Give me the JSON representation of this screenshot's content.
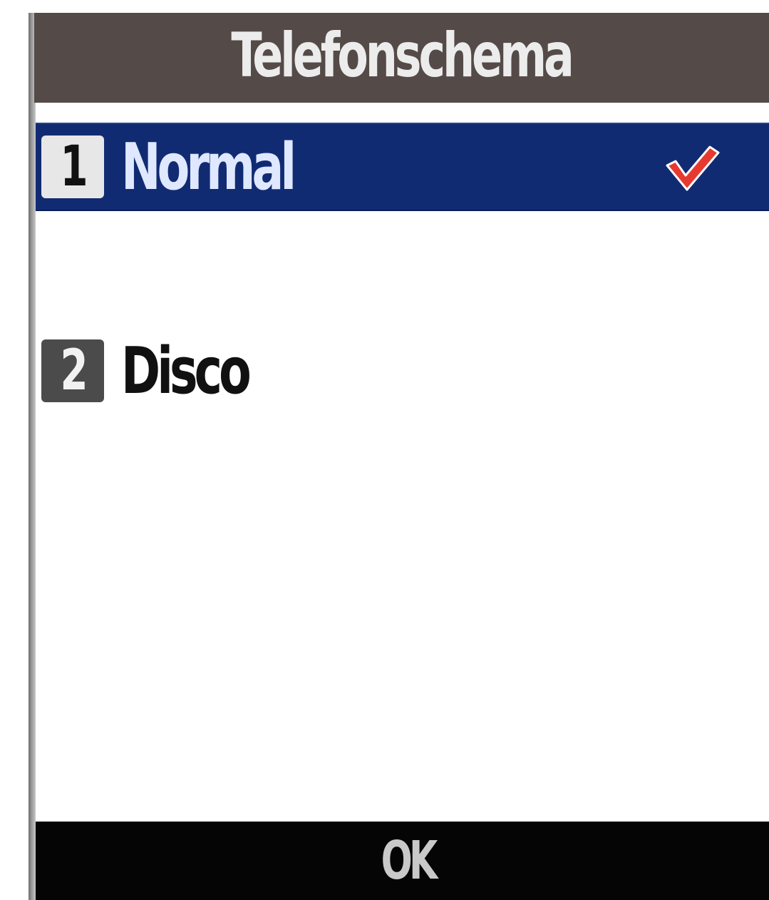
{
  "header": {
    "title": "Telefonschema"
  },
  "list": {
    "items": [
      {
        "number": "1",
        "label": "Normal",
        "selected": true,
        "checked": true
      },
      {
        "number": "2",
        "label": "Disco",
        "selected": false,
        "checked": false
      }
    ]
  },
  "softkeys": {
    "center_label": "OK"
  },
  "colors": {
    "title_bar": "#544a47",
    "selection": "#112b73",
    "check": "#e63a30",
    "softkey_bar": "#050505"
  },
  "icons": {
    "selected_marker": "checkmark-icon"
  }
}
